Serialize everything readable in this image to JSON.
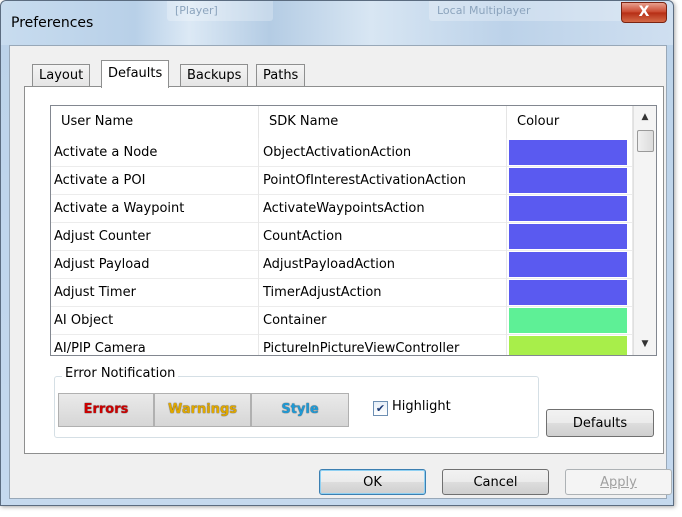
{
  "window": {
    "title": "Preferences",
    "close_glyph": "X"
  },
  "background_tabs": [
    "[Player]",
    "Local Multiplayer"
  ],
  "tabs": [
    {
      "label": "Layout",
      "active": false
    },
    {
      "label": "Defaults",
      "active": true
    },
    {
      "label": "Backups",
      "active": false
    },
    {
      "label": "Paths",
      "active": false
    }
  ],
  "table": {
    "headers": [
      "User Name",
      "SDK Name",
      "Colour"
    ],
    "rows": [
      {
        "user_name": "Activate a Node",
        "sdk_name": "ObjectActivationAction",
        "colour": "#5a5af0"
      },
      {
        "user_name": "Activate a POI",
        "sdk_name": "PointOfInterestActivationAction",
        "colour": "#5a5af0"
      },
      {
        "user_name": "Activate a Waypoint",
        "sdk_name": "ActivateWaypointsAction",
        "colour": "#5a5af0"
      },
      {
        "user_name": "Adjust Counter",
        "sdk_name": "CountAction",
        "colour": "#5a5af0"
      },
      {
        "user_name": "Adjust Payload",
        "sdk_name": "AdjustPayloadAction",
        "colour": "#5a5af0"
      },
      {
        "user_name": "Adjust Timer",
        "sdk_name": "TimerAdjustAction",
        "colour": "#5a5af0"
      },
      {
        "user_name": "AI Object",
        "sdk_name": "Container",
        "colour": "#5ef096"
      },
      {
        "user_name": "AI/PIP Camera",
        "sdk_name": "PictureInPictureViewController",
        "colour": "#a8ee4a"
      }
    ]
  },
  "error_notification": {
    "legend": "Error Notification",
    "errors_label": "Errors",
    "warnings_label": "Warnings",
    "style_label": "Style",
    "errors_color": "#cc0000",
    "warnings_color": "#e0a800",
    "style_color": "#1f9ad6",
    "highlight_label": "Highlight",
    "highlight_checked": true
  },
  "buttons": {
    "defaults_label": "Defaults",
    "ok_label": "OK",
    "cancel_label": "Cancel",
    "apply_label": "Apply"
  }
}
